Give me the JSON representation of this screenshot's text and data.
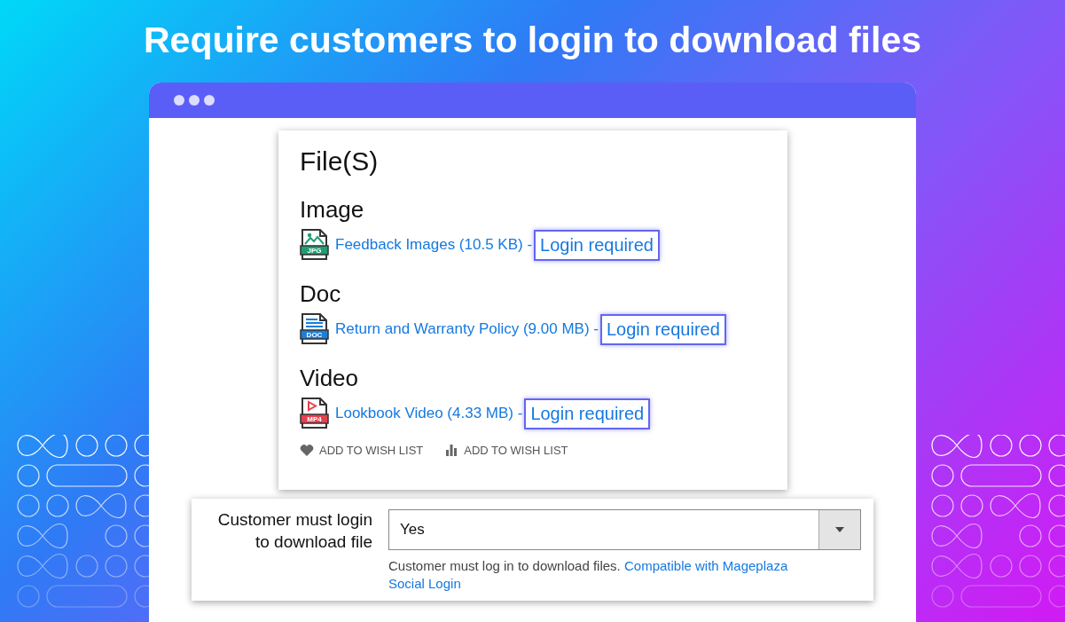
{
  "headline": "Require customers to login to download files",
  "files_panel": {
    "title": "File(S)",
    "groups": [
      {
        "heading": "Image",
        "kind": "jpg",
        "icon_label": "JPG",
        "file": "Feedback Images (10.5 KB) -",
        "action": "Login required"
      },
      {
        "heading": "Doc",
        "kind": "doc",
        "icon_label": "DOC",
        "file": "Return and Warranty Policy (9.00 MB) -",
        "action": "Login required"
      },
      {
        "heading": "Video",
        "kind": "mp4",
        "icon_label": "MP4",
        "file": "Lookbook Video (4.33 MB) -",
        "action": "Login required"
      }
    ],
    "actions": [
      {
        "kind": "wishlist",
        "label": "ADD TO WISH LIST"
      },
      {
        "kind": "compare",
        "label": "ADD TO WISH LIST"
      }
    ]
  },
  "setting": {
    "label": "Customer must login to download file",
    "value": "Yes",
    "note": "Customer must log in to download files.",
    "link_lines": [
      "Compatible with Mageplaza",
      "Social Login"
    ]
  }
}
